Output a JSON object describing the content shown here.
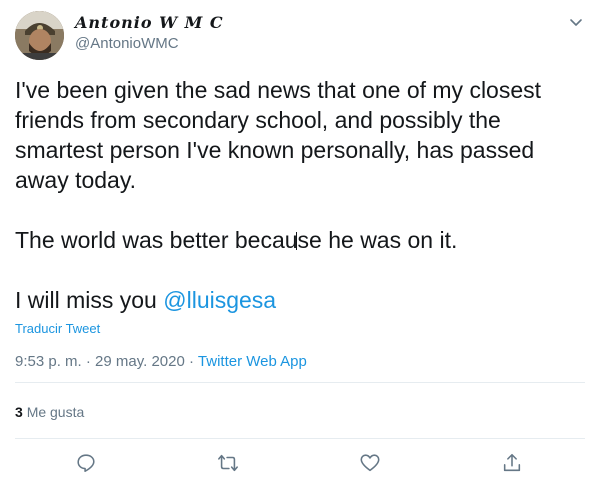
{
  "author": {
    "display_name": "Antonio W M C",
    "handle": "@AntonioWMC"
  },
  "tweet": {
    "lines": [
      "I've been given the sad news that one of my closest friends from secondary school, and possibly the smartest person I've known personally, has passed away today.",
      "The world was better because he was on it.",
      "I will miss you"
    ],
    "mention": "@lluisgesa",
    "translate_label": "Traducir Tweet"
  },
  "meta": {
    "time": "9:53 p. m.",
    "separator": "·",
    "date": "29 may. 2020",
    "source": "Twitter Web App"
  },
  "stats": {
    "likes_count": "3",
    "likes_label": "Me gusta"
  },
  "icons": {
    "menu": "chevron-down-icon",
    "reply": "reply-icon",
    "retweet": "retweet-icon",
    "like": "heart-icon",
    "share": "share-icon"
  },
  "colors": {
    "link": "#1b95e0",
    "secondary_text": "#657786",
    "divider": "#e6ecf0"
  }
}
